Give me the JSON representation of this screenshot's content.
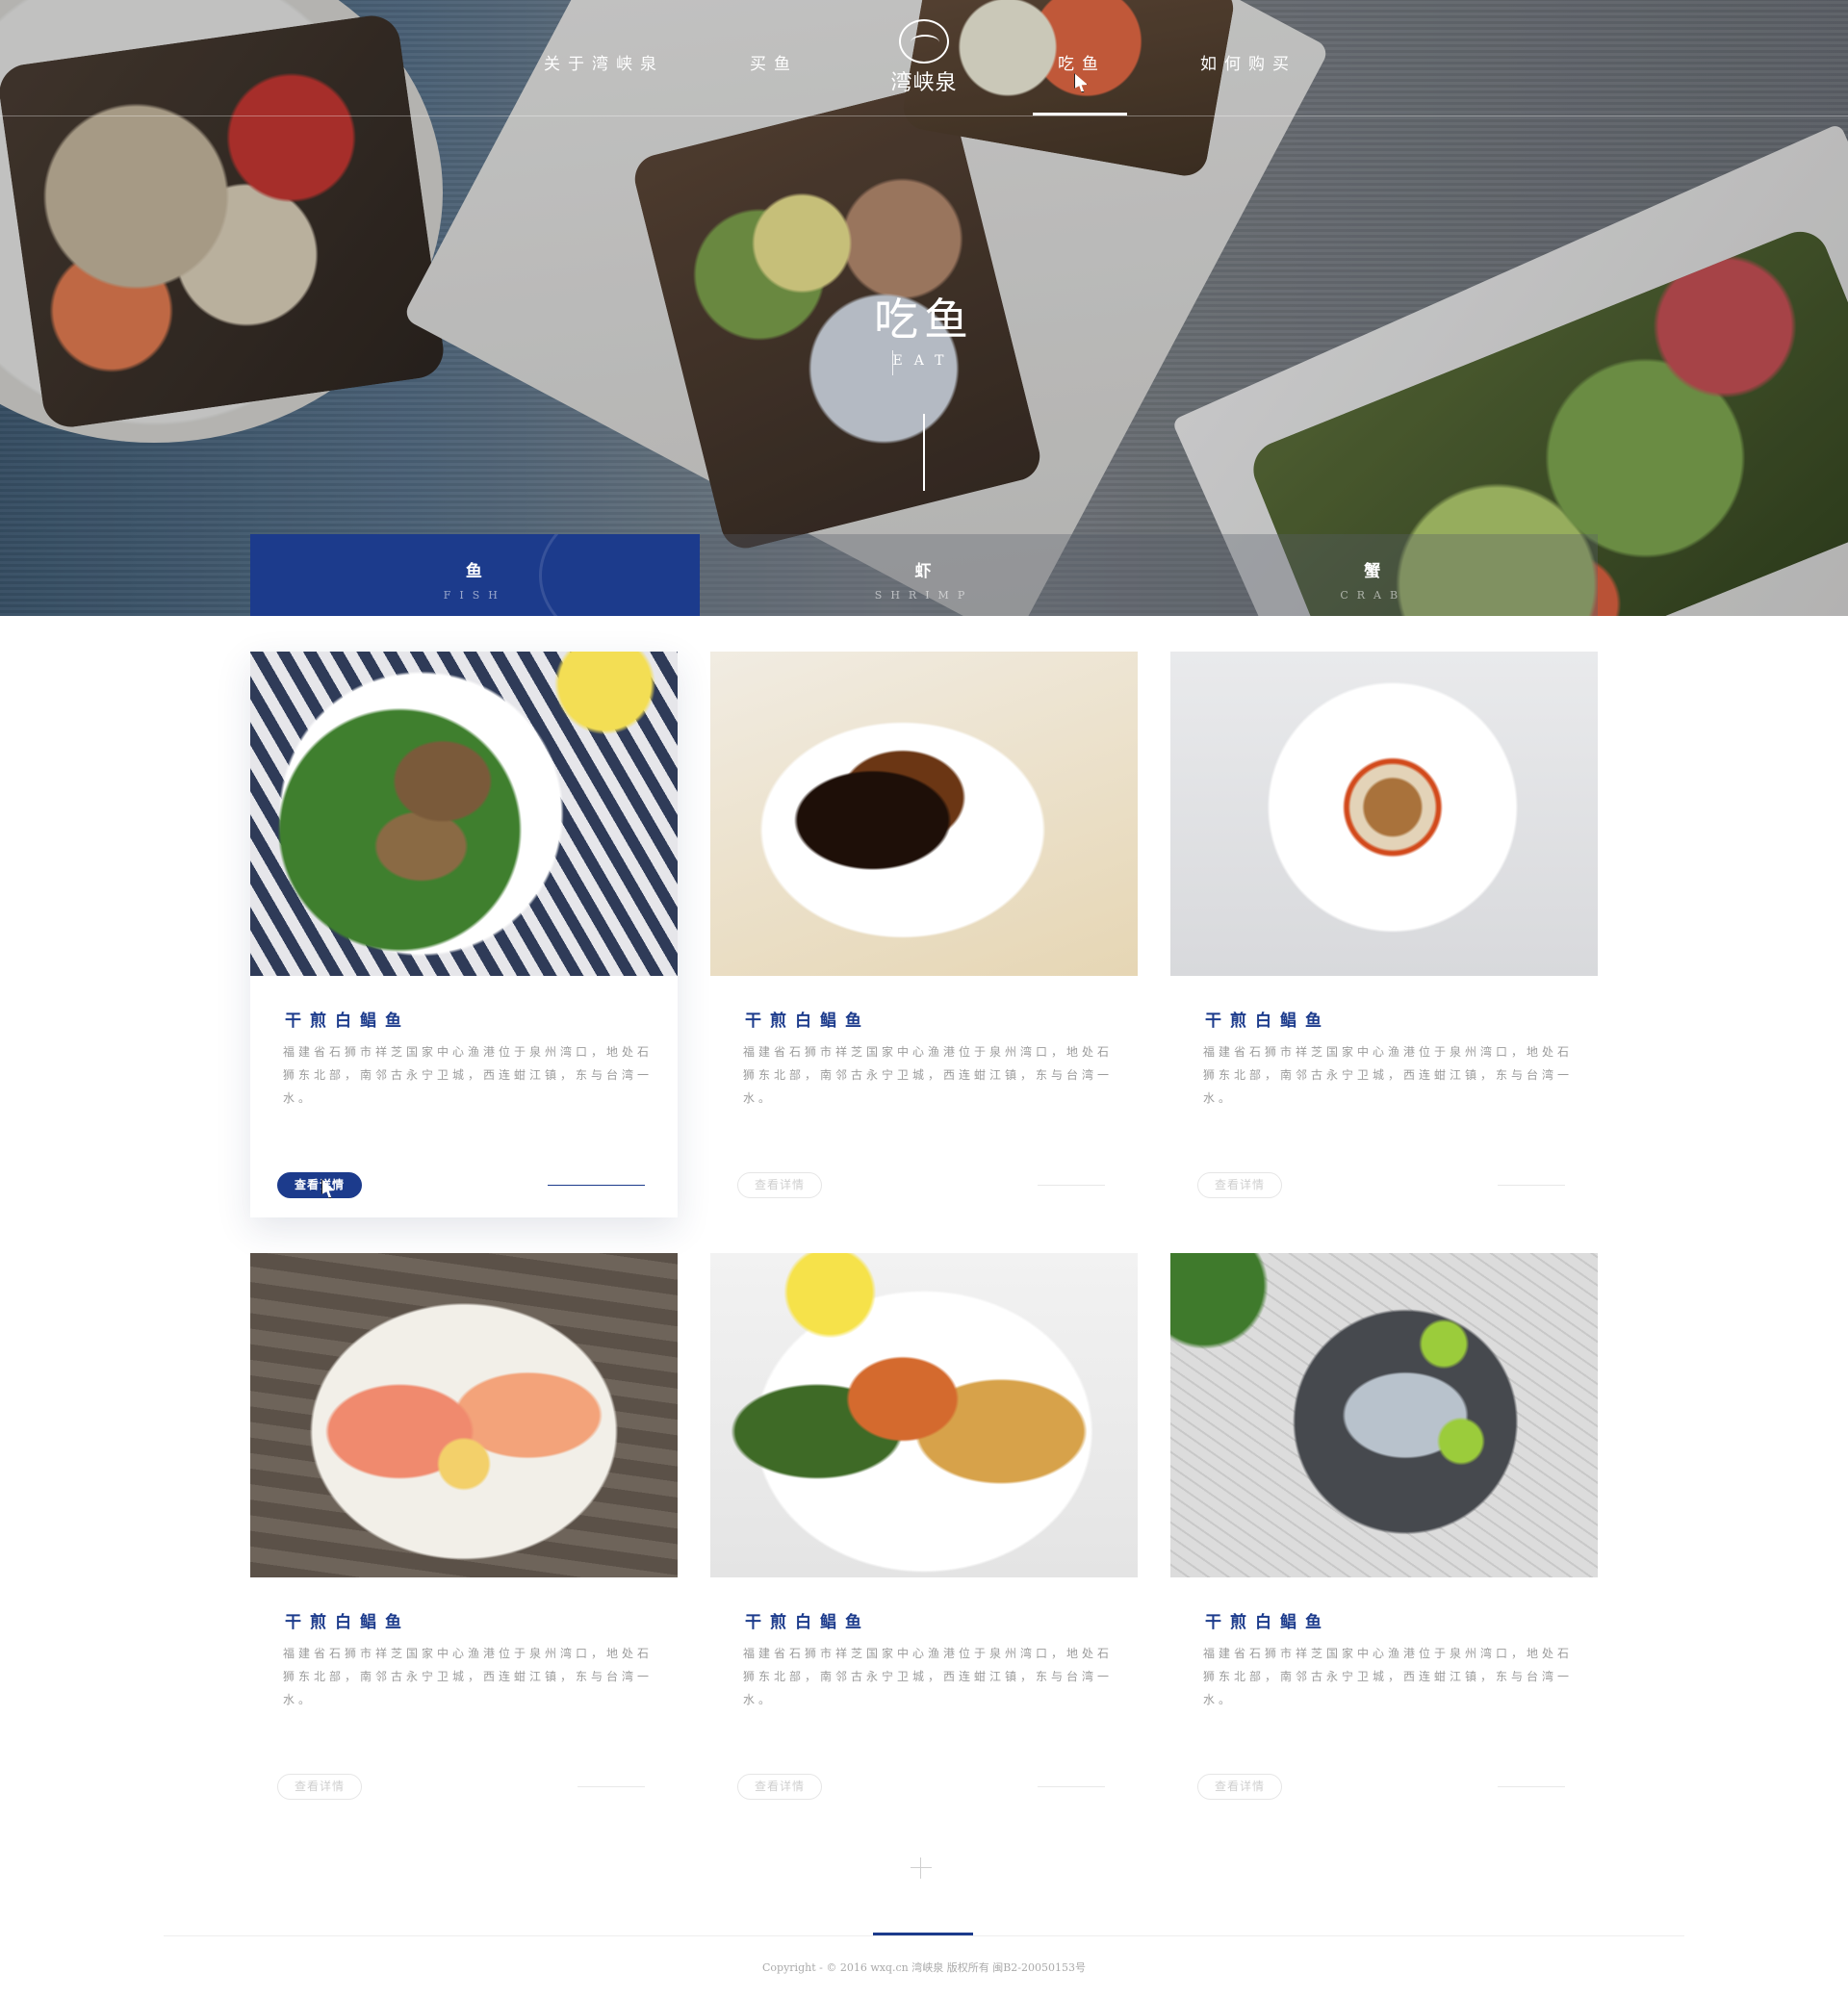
{
  "nav": {
    "items": [
      "关于湾峡泉",
      "买鱼",
      "吃鱼",
      "如何购买"
    ],
    "active": "吃鱼",
    "logo_text": "湾峡泉"
  },
  "hero": {
    "title": "吃鱼",
    "subtitle": "EAT"
  },
  "tabs": [
    {
      "cn": "鱼",
      "en": "FISH",
      "active": true
    },
    {
      "cn": "虾",
      "en": "SHRIMP",
      "active": false
    },
    {
      "cn": "蟹",
      "en": "CRAB",
      "active": false
    }
  ],
  "cards": [
    {
      "title": "干煎白鲳鱼",
      "desc": "福建省石狮市祥芝国家中心渔港位于泉州湾口，地处石狮东北部，南邻古永宁卫城，西连蚶江镇，东与台湾一水。",
      "button": "查看详情"
    },
    {
      "title": "干煎白鲳鱼",
      "desc": "福建省石狮市祥芝国家中心渔港位于泉州湾口，地处石狮东北部，南邻古永宁卫城，西连蚶江镇，东与台湾一水。",
      "button": "查看详情"
    },
    {
      "title": "干煎白鲳鱼",
      "desc": "福建省石狮市祥芝国家中心渔港位于泉州湾口，地处石狮东北部，南邻古永宁卫城，西连蚶江镇，东与台湾一水。",
      "button": "查看详情"
    },
    {
      "title": "干煎白鲳鱼",
      "desc": "福建省石狮市祥芝国家中心渔港位于泉州湾口，地处石狮东北部，南邻古永宁卫城，西连蚶江镇，东与台湾一水。",
      "button": "查看详情"
    },
    {
      "title": "干煎白鲳鱼",
      "desc": "福建省石狮市祥芝国家中心渔港位于泉州湾口，地处石狮东北部，南邻古永宁卫城，西连蚶江镇，东与台湾一水。",
      "button": "查看详情"
    },
    {
      "title": "干煎白鲳鱼",
      "desc": "福建省石狮市祥芝国家中心渔港位于泉州湾口，地处石狮东北部，南邻古永宁卫城，西连蚶江镇，东与台湾一水。",
      "button": "查看详情"
    }
  ],
  "footer": {
    "copyright": "Copyright - © 2016 wxq.cn 湾峡泉 版权所有 闽B2-20050153号"
  },
  "colors": {
    "brand": "#1c3b8c",
    "muted_text": "#9b9b9b"
  },
  "icons": [
    "logo-badge-icon",
    "plus-icon",
    "pointer-cursor-icon"
  ]
}
